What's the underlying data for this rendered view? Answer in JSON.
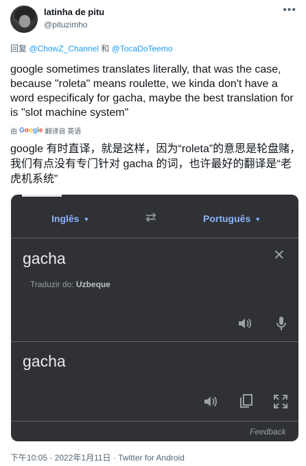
{
  "tweet": {
    "display_name": "latinha de pitu",
    "handle": "@pituzimho",
    "reply_prefix": "回复",
    "reply_mention_1": "@ChowZ_Channel",
    "reply_conjunction": "和",
    "reply_mention_2": "@TocaDoTeemo",
    "text": "google sometimes translates literally, that was the case, because \"roleta\" means roulette, we kinda don't have a word especificaly for gacha, maybe the best translation for is \"slot machine system\"",
    "translated_by_prefix": "由",
    "translated_by_suffix": "翻译自 英语",
    "translated_text": "google 有时直译，就是这样，因为“roleta”的意思是轮盘赌，我们有点没有专门针对 gacha 的词，也许最好的翻译是“老虎机系统”",
    "metadata": "下午10:05 · 2022年1月11日 · Twitter for Android",
    "more_icon": "ellipsis-icon"
  },
  "translator": {
    "source_lang": "Inglês",
    "target_lang": "Português",
    "source_text": "gacha",
    "detect_label": "Traduzir do: ",
    "detected_lang": "Uzbeque",
    "target_text": "gacha",
    "feedback": "Feedback",
    "colors": {
      "background": "#303134",
      "accent": "#8ab4f8"
    }
  }
}
